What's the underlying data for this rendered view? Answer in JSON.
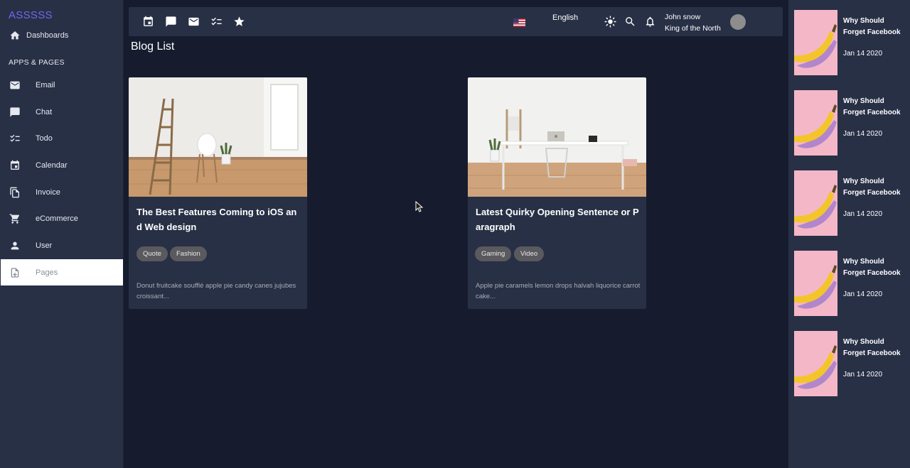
{
  "sidebar": {
    "brand": "ASSSSS",
    "dashboards": "Dashboards",
    "section": "APPS & PAGES",
    "items": [
      {
        "label": "Email",
        "icon": "mail-icon"
      },
      {
        "label": "Chat",
        "icon": "chat-icon"
      },
      {
        "label": "Todo",
        "icon": "todo-icon"
      },
      {
        "label": "Calendar",
        "icon": "calendar-icon"
      },
      {
        "label": "Invoice",
        "icon": "invoice-icon"
      },
      {
        "label": "eCommerce",
        "icon": "cart-icon"
      },
      {
        "label": "User",
        "icon": "user-icon"
      },
      {
        "label": "Pages",
        "icon": "pages-icon"
      }
    ],
    "active": "Pages"
  },
  "topbar": {
    "shortcuts": [
      "calendar-icon",
      "chat-icon",
      "mail-icon",
      "todo-icon",
      "star-icon"
    ],
    "language": "English",
    "flag": "us-flag-icon",
    "user_name": "John snow",
    "user_role": "King of the North"
  },
  "page": {
    "title": "Blog List"
  },
  "posts": [
    {
      "title": "The Best Features Coming to iOS and Web design",
      "tags": [
        "Quote",
        "Fashion"
      ],
      "excerpt": "Donut fruitcake soufflé apple pie candy canes jujubes croissant..."
    },
    {
      "title": "Latest Quirky Opening Sentence or Paragraph",
      "tags": [
        "Gaming",
        "Video"
      ],
      "excerpt": "Apple pie caramels lemon drops halvah liquorice carrot cake..."
    }
  ],
  "recent": [
    {
      "title": "Why Should Forget Facebook",
      "date": "Jan 14 2020"
    },
    {
      "title": "Why Should Forget Facebook",
      "date": "Jan 14 2020"
    },
    {
      "title": "Why Should Forget Facebook",
      "date": "Jan 14 2020"
    },
    {
      "title": "Why Should Forget Facebook",
      "date": "Jan 14 2020"
    },
    {
      "title": "Why Should Forget Facebook",
      "date": "Jan 14 2020"
    }
  ],
  "colors": {
    "accent": "#7367f0",
    "background": "#161c2e",
    "panel": "#283046",
    "chip": "#5a5a5e",
    "thumb_pink": "#f4b7c8"
  }
}
